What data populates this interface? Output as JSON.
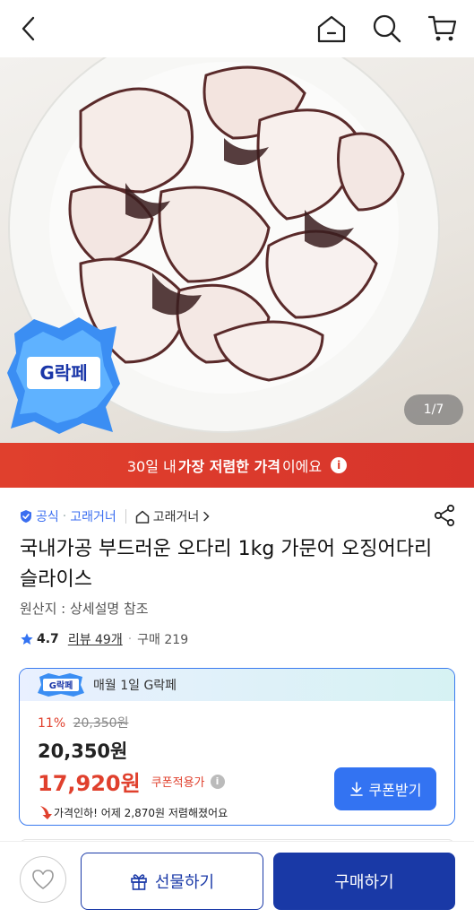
{
  "nav": {
    "back_icon": "chevron-left-icon",
    "home_icon": "home-icon",
    "search_icon": "search-icon",
    "cart_icon": "cart-icon"
  },
  "hero": {
    "counter": "1/7",
    "badge_text": "G락페"
  },
  "banner": {
    "prefix": "30일 내 ",
    "emphasis": "가장 저렴한 가격",
    "suffix": "이에요",
    "info_glyph": "i"
  },
  "seller": {
    "official_label": "공식",
    "store_name": "고래거너",
    "store_link": "고래거너"
  },
  "product": {
    "title": "국내가공 부드러운 오다리 1kg 가문어 오징어다리 슬라이스",
    "origin": "원산지 : 상세설명 참조",
    "rating": "4.7",
    "reviews": "리뷰 49개",
    "purchases": "구매 219"
  },
  "price_card": {
    "header_badge": "G락페",
    "header_text": "매월 1일 G락페",
    "discount_pct": "11%",
    "original_price": "20,350원",
    "price": "20,350원",
    "coupon_price": "17,920원",
    "coupon_note": "쿠폰적용가",
    "price_drop": "가격인하! 어제 2,870원 저렴해졌어요",
    "coupon_button": "쿠폰받기"
  },
  "bottom": {
    "gift_label": "선물하기",
    "buy_label": "구매하기"
  },
  "colors": {
    "accent_blue": "#3373f2",
    "navy": "#1939a6",
    "red": "#e0402d"
  }
}
